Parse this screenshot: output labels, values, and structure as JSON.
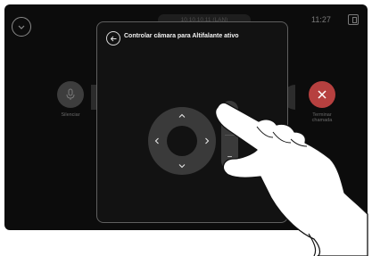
{
  "status_bar": {
    "ip_address": "10.10.10.11 (LAN)",
    "time": "11:27",
    "icons": {
      "collapse": "chevron-down-icon",
      "layout": "layout-icon"
    }
  },
  "call_controls": {
    "mute_label": "Silenciar",
    "end_call_label_line1": "Terminar",
    "end_call_label_line2": "chamada",
    "icons": {
      "mute": "microphone-icon",
      "end": "close-icon"
    }
  },
  "camera_dialog": {
    "title": "Controlar câmara para Altifalante ativo",
    "back_icon": "arrow-left-icon",
    "zoom_in": "+",
    "zoom_out": "−"
  },
  "colors": {
    "screen_bg": "#0c0c0c",
    "dialog_bg": "#121212",
    "control_gray": "#3a3a3a",
    "end_call_red": "#b6403f"
  }
}
